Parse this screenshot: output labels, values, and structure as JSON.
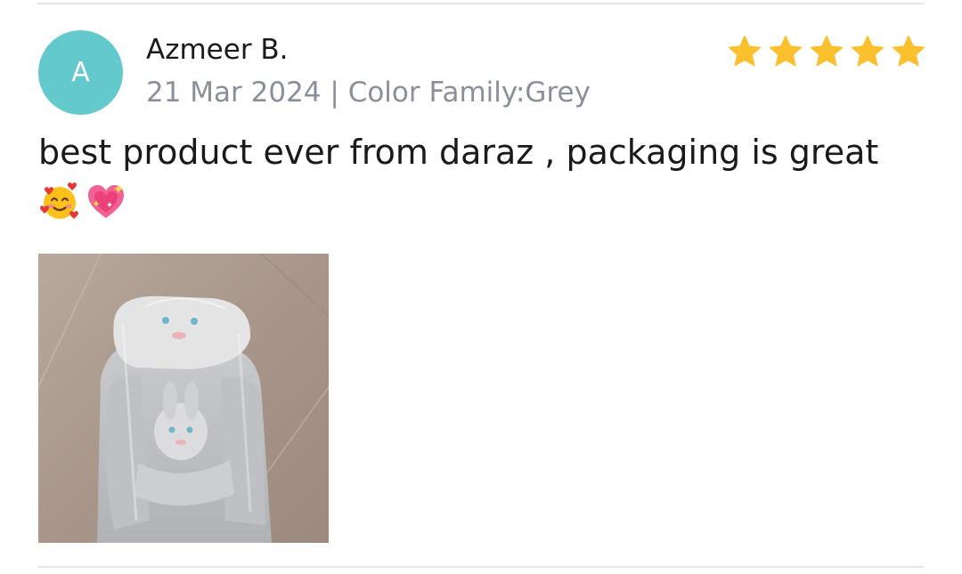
{
  "review": {
    "avatar_initial": "A",
    "reviewer_name": "Azmeer B.",
    "meta": "21 Mar 2024 | Color Family:Grey",
    "rating": 5,
    "rating_max": 5,
    "text": "best product ever from daraz , packaging is great",
    "emojis": [
      "smiling-face-with-hearts-icon",
      "sparkling-heart-icon"
    ],
    "photo_subject": "baby bouncer in plastic packaging"
  },
  "colors": {
    "avatar_bg": "#63c9cc",
    "star": "#fbc02d",
    "meta_text": "#8a8f99",
    "divider": "#e6e6e6"
  }
}
